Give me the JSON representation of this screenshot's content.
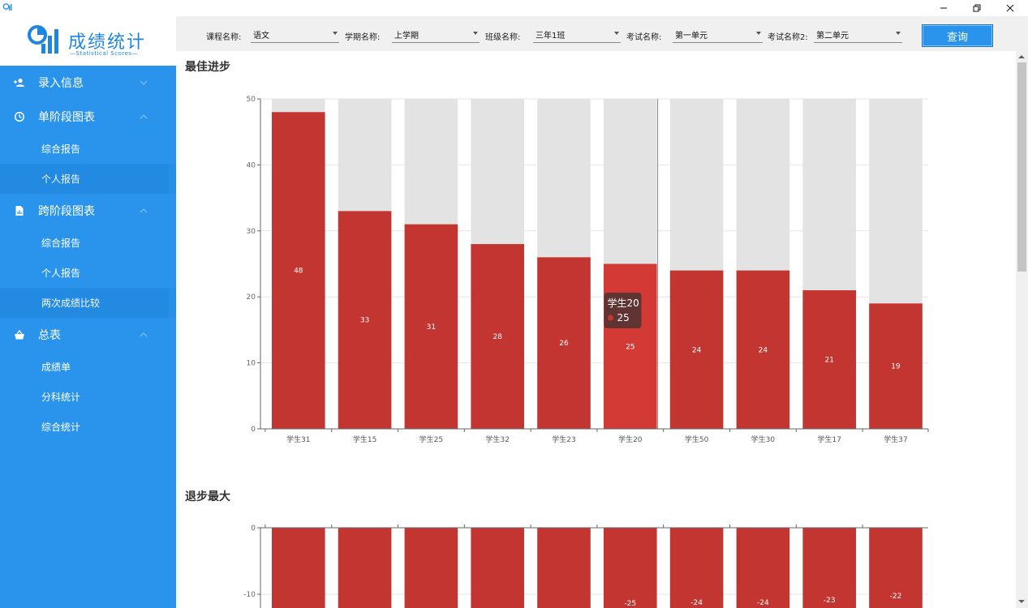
{
  "window": {
    "controls": [
      "minimize-button",
      "restore-button",
      "close-button"
    ]
  },
  "logo": {
    "title": "成绩统计",
    "subtitle": "—Statistical Scores—"
  },
  "sidebar": {
    "groups": [
      {
        "label": "录入信息",
        "icon": "user-add-icon",
        "expanded": false,
        "items": []
      },
      {
        "label": "单阶段图表",
        "icon": "clock-icon",
        "expanded": true,
        "items": [
          "综合报告",
          "个人报告"
        ]
      },
      {
        "label": "跨阶段图表",
        "icon": "document-icon",
        "expanded": true,
        "items": [
          "综合报告",
          "个人报告",
          "两次成绩比较"
        ]
      },
      {
        "label": "总表",
        "icon": "basket-icon",
        "expanded": true,
        "items": [
          "成绩单",
          "分科统计",
          "综合统计"
        ]
      }
    ],
    "active_item": "两次成绩比较"
  },
  "filters": {
    "course_label": "课程名称:",
    "course_value": "语文",
    "term_label": "学期名称:",
    "term_value": "上学期",
    "class_label": "班级名称:",
    "class_value": "三年1班",
    "exam_label": "考试名称:",
    "exam_value": "第一单元",
    "exam2_label": "考试名称2:",
    "exam2_value": "第二单元",
    "query_label": "查询"
  },
  "sections": {
    "best_title": "最佳进步",
    "worst_title": "退步最大"
  },
  "colors": {
    "accent": "#2a94ec",
    "bar": "#c23531",
    "bar_highlight": "#d33a35",
    "bar_bg": "#e3e3e3"
  },
  "chart_data": [
    {
      "type": "bar",
      "title": "最佳进步",
      "categories": [
        "学生31",
        "学生15",
        "学生25",
        "学生32",
        "学生23",
        "学生20",
        "学生50",
        "学生30",
        "学生17",
        "学生37"
      ],
      "values": [
        48,
        33,
        31,
        28,
        26,
        25,
        24,
        24,
        21,
        19
      ],
      "data_labels": [
        "48",
        "33",
        "31",
        "28",
        "26",
        "25",
        "24",
        "24",
        "21",
        "19"
      ],
      "ylim": [
        0,
        50
      ],
      "yticks": [
        0,
        10,
        20,
        30,
        40,
        50
      ],
      "background_bars": true,
      "tooltip": {
        "category": "学生20",
        "value": "25"
      }
    },
    {
      "type": "bar",
      "title": "退步最大",
      "yticks": [
        0,
        -10
      ],
      "data_labels": [
        "-25",
        "-24",
        "-24",
        "-23",
        "-22"
      ],
      "partial": true
    }
  ]
}
